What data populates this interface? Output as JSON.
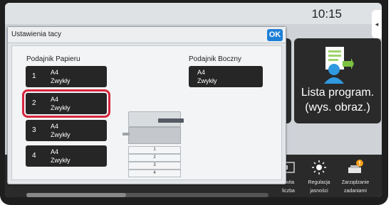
{
  "status": {
    "time": "10:15"
  },
  "dialog": {
    "title": "Ustawienia tacy",
    "ok_label": "OK",
    "main_tray_label": "Podajnik Papieru",
    "bypass_label": "Podajnik Boczny",
    "trays": [
      {
        "num": "1",
        "size": "A4",
        "type": "Zwykły",
        "selected": false
      },
      {
        "num": "2",
        "size": "A4",
        "type": "Zwykły",
        "selected": true
      },
      {
        "num": "3",
        "size": "A4",
        "type": "Zwykły",
        "selected": false
      },
      {
        "num": "4",
        "size": "A4",
        "type": "Zwykły",
        "selected": false
      }
    ],
    "bypass": {
      "size": "A4",
      "type": "Zwykły"
    },
    "printer_cassettes": [
      "1",
      "2",
      "3",
      "4"
    ]
  },
  "home": {
    "lista_label_line1": "Lista program.",
    "lista_label_line2": "(wys. obraz.)"
  },
  "bottom_bar": {
    "items": [
      {
        "label_line1": "owita",
        "label_line2": "liczba",
        "icon": "counter-icon"
      },
      {
        "label_line1": "Regulacja",
        "label_line2": "jasności",
        "icon": "brightness-icon"
      },
      {
        "label_line1": "Zarządzanie",
        "label_line2": "zadaniami",
        "icon": "job-status-icon"
      }
    ]
  },
  "colors": {
    "ok_button": "#1d7fd6",
    "selection_outline": "#d7263d",
    "tray_button_bg": "#262626"
  }
}
